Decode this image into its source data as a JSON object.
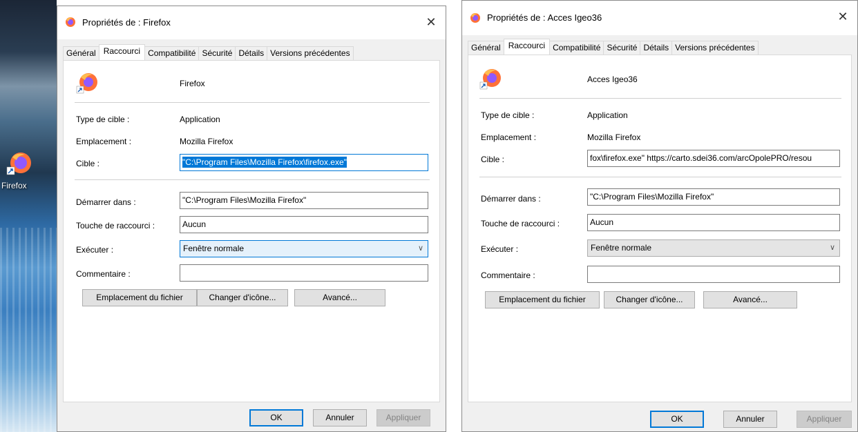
{
  "desktop": {
    "icon_label": "Firefox"
  },
  "dialog1": {
    "title": "Propriétés de : Firefox",
    "tabs": [
      "Général",
      "Raccourci",
      "Compatibilité",
      "Sécurité",
      "Détails",
      "Versions précédentes"
    ],
    "name": "Firefox",
    "type_label": "Type de cible :",
    "type_value": "Application",
    "location_label": "Emplacement :",
    "location_value": "Mozilla Firefox",
    "target_label": "Cible :",
    "target_value": "\"C:\\Program Files\\Mozilla Firefox\\firefox.exe\"",
    "startin_label": "Démarrer dans :",
    "startin_value": "\"C:\\Program Files\\Mozilla Firefox\"",
    "hotkey_label": "Touche de raccourci :",
    "hotkey_value": "Aucun",
    "run_label": "Exécuter :",
    "run_value": "Fenêtre normale",
    "comment_label": "Commentaire :",
    "comment_value": "",
    "btn_open_location": "Emplacement du fichier",
    "btn_change_icon": "Changer d'icône...",
    "btn_advanced": "Avancé...",
    "btn_ok": "OK",
    "btn_cancel": "Annuler",
    "btn_apply": "Appliquer"
  },
  "dialog2": {
    "title": "Propriétés de : Acces Igeo36",
    "tabs": [
      "Général",
      "Raccourci",
      "Compatibilité",
      "Sécurité",
      "Détails",
      "Versions précédentes"
    ],
    "name": "Acces Igeo36",
    "type_label": "Type de cible :",
    "type_value": "Application",
    "location_label": "Emplacement :",
    "location_value": "Mozilla Firefox",
    "target_label": "Cible :",
    "target_value": "fox\\firefox.exe\" https://carto.sdei36.com/arcOpolePRO/resou",
    "startin_label": "Démarrer dans :",
    "startin_value": "\"C:\\Program Files\\Mozilla Firefox\"",
    "hotkey_label": "Touche de raccourci :",
    "hotkey_value": "Aucun",
    "run_label": "Exécuter :",
    "run_value": "Fenêtre normale",
    "comment_label": "Commentaire :",
    "comment_value": "",
    "btn_open_location": "Emplacement du fichier",
    "btn_change_icon": "Changer d'icône...",
    "btn_advanced": "Avancé...",
    "btn_ok": "OK",
    "btn_cancel": "Annuler",
    "btn_apply": "Appliquer"
  },
  "icons": {
    "app": "firefox-icon",
    "close": "close-icon",
    "dropdown": "chevron-down-icon",
    "shortcut_overlay": "shortcut-arrow-icon"
  }
}
